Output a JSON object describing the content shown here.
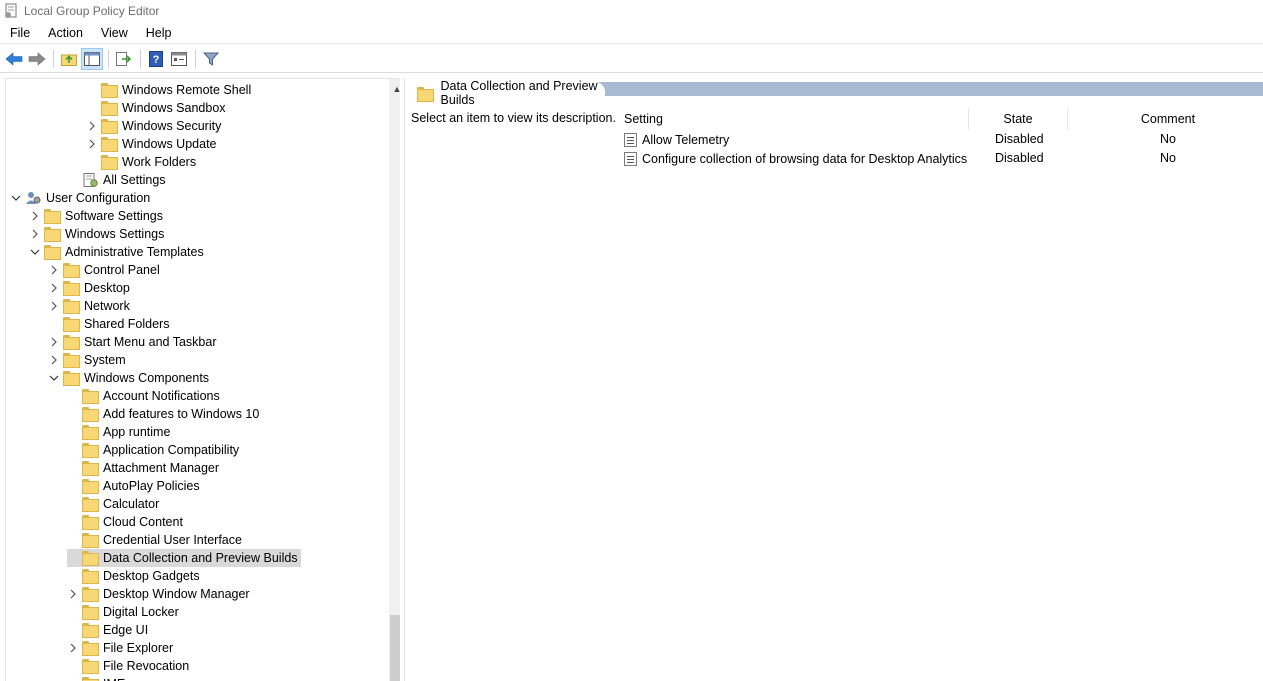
{
  "window": {
    "title": "Local Group Policy Editor"
  },
  "menu": [
    "File",
    "Action",
    "View",
    "Help"
  ],
  "toolbar": {
    "buttons": [
      "back-arrow-icon",
      "forward-arrow-icon",
      "up-folder-icon",
      "show-hide-tree-icon",
      "export-list-icon",
      "help-icon",
      "properties-icon",
      "filter-icon"
    ]
  },
  "tree": {
    "items": [
      {
        "label": "Windows Remote Shell",
        "depth": 4,
        "expander": "",
        "icon": "folder"
      },
      {
        "label": "Windows Sandbox",
        "depth": 4,
        "expander": "",
        "icon": "folder"
      },
      {
        "label": "Windows Security",
        "depth": 4,
        "expander": ">",
        "icon": "folder"
      },
      {
        "label": "Windows Update",
        "depth": 4,
        "expander": ">",
        "icon": "folder"
      },
      {
        "label": "Work Folders",
        "depth": 4,
        "expander": "",
        "icon": "folder"
      },
      {
        "label": "All Settings",
        "depth": 3,
        "expander": "",
        "icon": "settings"
      },
      {
        "label": "User Configuration",
        "depth": 0,
        "expander": "v",
        "icon": "user"
      },
      {
        "label": "Software Settings",
        "depth": 1,
        "expander": ">",
        "icon": "folder"
      },
      {
        "label": "Windows Settings",
        "depth": 1,
        "expander": ">",
        "icon": "folder"
      },
      {
        "label": "Administrative Templates",
        "depth": 1,
        "expander": "v",
        "icon": "folder"
      },
      {
        "label": "Control Panel",
        "depth": 2,
        "expander": ">",
        "icon": "folder"
      },
      {
        "label": "Desktop",
        "depth": 2,
        "expander": ">",
        "icon": "folder"
      },
      {
        "label": "Network",
        "depth": 2,
        "expander": ">",
        "icon": "folder"
      },
      {
        "label": "Shared Folders",
        "depth": 2,
        "expander": "",
        "icon": "folder"
      },
      {
        "label": "Start Menu and Taskbar",
        "depth": 2,
        "expander": ">",
        "icon": "folder"
      },
      {
        "label": "System",
        "depth": 2,
        "expander": ">",
        "icon": "folder"
      },
      {
        "label": "Windows Components",
        "depth": 2,
        "expander": "v",
        "icon": "folder"
      },
      {
        "label": "Account Notifications",
        "depth": 3,
        "expander": "",
        "icon": "folder"
      },
      {
        "label": "Add features to Windows 10",
        "depth": 3,
        "expander": "",
        "icon": "folder"
      },
      {
        "label": "App runtime",
        "depth": 3,
        "expander": "",
        "icon": "folder"
      },
      {
        "label": "Application Compatibility",
        "depth": 3,
        "expander": "",
        "icon": "folder"
      },
      {
        "label": "Attachment Manager",
        "depth": 3,
        "expander": "",
        "icon": "folder"
      },
      {
        "label": "AutoPlay Policies",
        "depth": 3,
        "expander": "",
        "icon": "folder"
      },
      {
        "label": "Calculator",
        "depth": 3,
        "expander": "",
        "icon": "folder"
      },
      {
        "label": "Cloud Content",
        "depth": 3,
        "expander": "",
        "icon": "folder"
      },
      {
        "label": "Credential User Interface",
        "depth": 3,
        "expander": "",
        "icon": "folder"
      },
      {
        "label": "Data Collection and Preview Builds",
        "depth": 3,
        "expander": "",
        "icon": "folder",
        "selected": true
      },
      {
        "label": "Desktop Gadgets",
        "depth": 3,
        "expander": "",
        "icon": "folder"
      },
      {
        "label": "Desktop Window Manager",
        "depth": 3,
        "expander": ">",
        "icon": "folder"
      },
      {
        "label": "Digital Locker",
        "depth": 3,
        "expander": "",
        "icon": "folder"
      },
      {
        "label": "Edge UI",
        "depth": 3,
        "expander": "",
        "icon": "folder"
      },
      {
        "label": "File Explorer",
        "depth": 3,
        "expander": ">",
        "icon": "folder"
      },
      {
        "label": "File Revocation",
        "depth": 3,
        "expander": "",
        "icon": "folder"
      },
      {
        "label": "IME",
        "depth": 3,
        "expander": "",
        "icon": "folder"
      }
    ]
  },
  "details": {
    "header": "Data Collection and Preview Builds",
    "description": "Select an item to view its description.",
    "columns": {
      "setting": "Setting",
      "state": "State",
      "comment": "Comment"
    },
    "rows": [
      {
        "setting": "Allow Telemetry",
        "state": "Disabled",
        "comment": "No"
      },
      {
        "setting": "Configure collection of browsing data for Desktop Analytics",
        "state": "Disabled",
        "comment": "No"
      }
    ]
  }
}
